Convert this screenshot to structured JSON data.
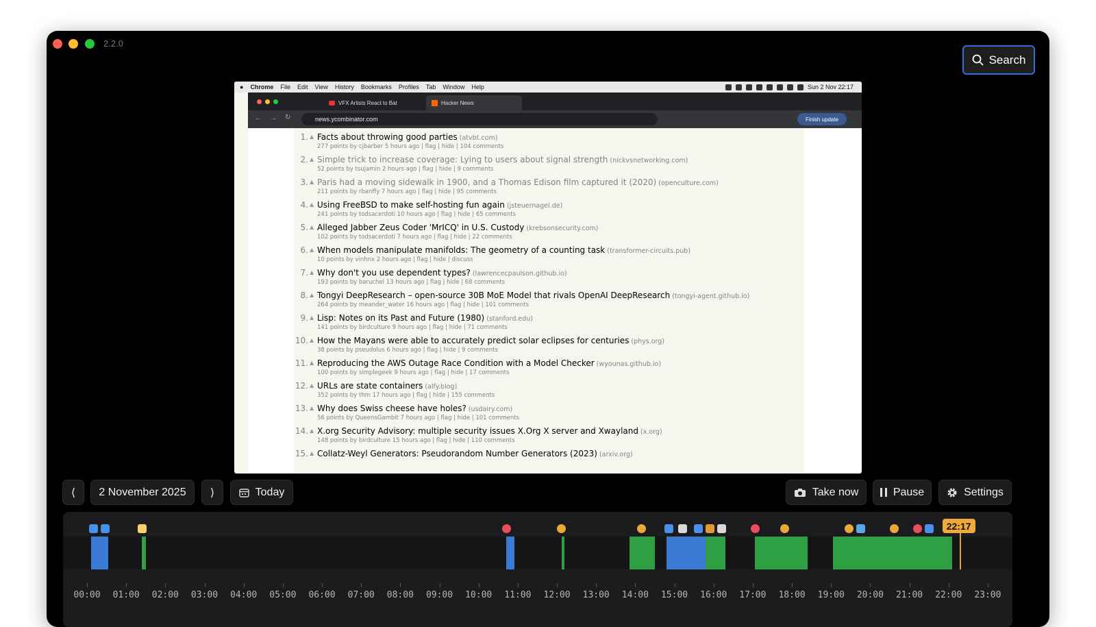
{
  "app": {
    "version": "2.2.0"
  },
  "search": {
    "label": "Search",
    "icon": "magnifier"
  },
  "colors": {
    "accent_border": "#2f6fd6",
    "timeline_green": "#2ea043",
    "timeline_blue": "#3a7bd5",
    "now_marker": "#f0a93b"
  },
  "screenshot": {
    "menubar": {
      "app": "Chrome",
      "items": [
        "File",
        "Edit",
        "View",
        "History",
        "Bookmarks",
        "Profiles",
        "Tab",
        "Window",
        "Help"
      ],
      "clock": "Sun 2 Nov  22:17"
    },
    "tabs": [
      {
        "label": "VFX Artists React to Bat"
      },
      {
        "label": "Hacker News"
      }
    ],
    "address": "news.ycombinator.com",
    "finish_update": "Finish update",
    "stories": [
      {
        "rank": "1.",
        "title": "Facts about throwing good parties",
        "site": "(atvbt.com)",
        "sub": "277 points by cjbarber 5 hours ago | flag | hide | 104 comments",
        "visited": false
      },
      {
        "rank": "2.",
        "title": "Simple trick to increase coverage: Lying to users about signal strength",
        "site": "(nickvsnetworking.com)",
        "sub": "52 points by tsujamin 2 hours ago | flag | hide | 9 comments",
        "visited": true
      },
      {
        "rank": "3.",
        "title": "Paris had a moving sidewalk in 1900, and a Thomas Edison film captured it (2020)",
        "site": "(openculture.com)",
        "sub": "211 points by rbanffy 7 hours ago | flag | hide | 95 comments",
        "visited": true
      },
      {
        "rank": "4.",
        "title": "Using FreeBSD to make self-hosting fun again",
        "site": "(jsteuernagel.de)",
        "sub": "241 points by todsacerdoti 10 hours ago | flag | hide | 65 comments",
        "visited": false
      },
      {
        "rank": "5.",
        "title": "Alleged Jabber Zeus Coder 'MrICQ' in U.S. Custody",
        "site": "(krebsonsecurity.com)",
        "sub": "102 points by todsacerdoti 7 hours ago | flag | hide | 22 comments",
        "visited": false
      },
      {
        "rank": "6.",
        "title": "When models manipulate manifolds: The geometry of a counting task",
        "site": "(transformer-circuits.pub)",
        "sub": "10 points by vinhnx 2 hours ago | flag | hide | discuss",
        "visited": false
      },
      {
        "rank": "7.",
        "title": "Why don't you use dependent types?",
        "site": "(lawrencecpaulson.github.io)",
        "sub": "193 points by baruchel 13 hours ago | flag | hide | 68 comments",
        "visited": false
      },
      {
        "rank": "8.",
        "title": "Tongyi DeepResearch – open-source 30B MoE Model that rivals OpenAI DeepResearch",
        "site": "(tongyi-agent.github.io)",
        "sub": "264 points by meander_water 16 hours ago | flag | hide | 101 comments",
        "visited": false
      },
      {
        "rank": "9.",
        "title": "Lisp: Notes on its Past and Future (1980)",
        "site": "(stanford.edu)",
        "sub": "141 points by birdculture 9 hours ago | flag | hide | 71 comments",
        "visited": false
      },
      {
        "rank": "10.",
        "title": "How the Mayans were able to accurately predict solar eclipses for centuries",
        "site": "(phys.org)",
        "sub": "38 points by pseudolus 6 hours ago | flag | hide | 9 comments",
        "visited": false
      },
      {
        "rank": "11.",
        "title": "Reproducing the AWS Outage Race Condition with a Model Checker",
        "site": "(wyounas.github.io)",
        "sub": "100 points by simplegeek 9 hours ago | flag | hide | 17 comments",
        "visited": false
      },
      {
        "rank": "12.",
        "title": "URLs are state containers",
        "site": "(alfy.blog)",
        "sub": "352 points by thm 17 hours ago | flag | hide | 155 comments",
        "visited": false
      },
      {
        "rank": "13.",
        "title": "Why does Swiss cheese have holes?",
        "site": "(usdairy.com)",
        "sub": "56 points by QueensGambit 7 hours ago | flag | hide | 101 comments",
        "visited": false
      },
      {
        "rank": "14.",
        "title": "X.org Security Advisory: multiple security issues X.Org X server and Xwayland",
        "site": "(x.org)",
        "sub": "148 points by birdculture 15 hours ago | flag | hide | 110 comments",
        "visited": false
      },
      {
        "rank": "15.",
        "title": "Collatz-Weyl Generators: Pseudorandom Number Generators (2023)",
        "site": "(arxiv.org)",
        "sub": "",
        "visited": false
      }
    ]
  },
  "controls": {
    "prev": "⟨",
    "date": "2 November 2025",
    "next": "⟩",
    "today": "Today",
    "take_now": "Take now",
    "pause": "Pause",
    "settings": "Settings"
  },
  "timeline": {
    "hours": [
      "00:00",
      "01:00",
      "02:00",
      "03:00",
      "04:00",
      "05:00",
      "06:00",
      "07:00",
      "08:00",
      "09:00",
      "10:00",
      "11:00",
      "12:00",
      "13:00",
      "14:00",
      "15:00",
      "16:00",
      "17:00",
      "18:00",
      "19:00",
      "20:00",
      "21:00",
      "22:00",
      "23:00"
    ],
    "current_time": "22:17",
    "current_hour_value": 22.28,
    "segments": [
      {
        "start": 0.1,
        "end": 0.55,
        "color": "#3a7bd5"
      },
      {
        "start": 1.4,
        "end": 1.5,
        "color": "#2ea043"
      },
      {
        "start": 10.7,
        "end": 10.92,
        "color": "#3a7bd5"
      },
      {
        "start": 12.13,
        "end": 12.2,
        "color": "#2ea043"
      },
      {
        "start": 13.85,
        "end": 14.5,
        "color": "#2ea043"
      },
      {
        "start": 14.8,
        "end": 15.8,
        "color": "#3a7bd5"
      },
      {
        "start": 15.8,
        "end": 16.3,
        "color": "#2ea043"
      },
      {
        "start": 17.05,
        "end": 18.4,
        "color": "#2ea043"
      },
      {
        "start": 19.05,
        "end": 20.0,
        "color": "#2ea043"
      },
      {
        "start": 20.0,
        "end": 22.1,
        "color": "#2ea043"
      }
    ],
    "app_icons": [
      {
        "hour": 0.15,
        "name": "xcode-icon",
        "color": "#4a8fe8"
      },
      {
        "hour": 0.45,
        "name": "xcode-icon",
        "color": "#4a8fe8"
      },
      {
        "hour": 1.4,
        "name": "notes-icon",
        "color": "#f5d26b"
      },
      {
        "hour": 10.7,
        "name": "record-icon",
        "color": "#e94c5a"
      },
      {
        "hour": 12.1,
        "name": "chrome-icon",
        "color": "#e9a93a"
      },
      {
        "hour": 14.15,
        "name": "chrome-icon",
        "color": "#e9a93a"
      },
      {
        "hour": 14.85,
        "name": "finder-icon",
        "color": "#4a8fe8"
      },
      {
        "hour": 15.2,
        "name": "script-icon",
        "color": "#d8d8d8"
      },
      {
        "hour": 15.6,
        "name": "xcode-icon",
        "color": "#4a8fe8"
      },
      {
        "hour": 15.9,
        "name": "terminal-icon",
        "color": "#e09a3a"
      },
      {
        "hour": 16.2,
        "name": "script-icon",
        "color": "#d8d8d8"
      },
      {
        "hour": 17.05,
        "name": "record-icon",
        "color": "#e94c5a"
      },
      {
        "hour": 17.8,
        "name": "chrome-icon",
        "color": "#e9a93a"
      },
      {
        "hour": 19.45,
        "name": "chrome-icon",
        "color": "#e9a93a"
      },
      {
        "hour": 19.75,
        "name": "claude-icon",
        "color": "#5aa6e8"
      },
      {
        "hour": 20.6,
        "name": "chrome-icon",
        "color": "#e9a93a"
      },
      {
        "hour": 21.2,
        "name": "record-icon",
        "color": "#e94c5a"
      },
      {
        "hour": 21.5,
        "name": "xcode-icon",
        "color": "#4a8fe8"
      }
    ]
  }
}
